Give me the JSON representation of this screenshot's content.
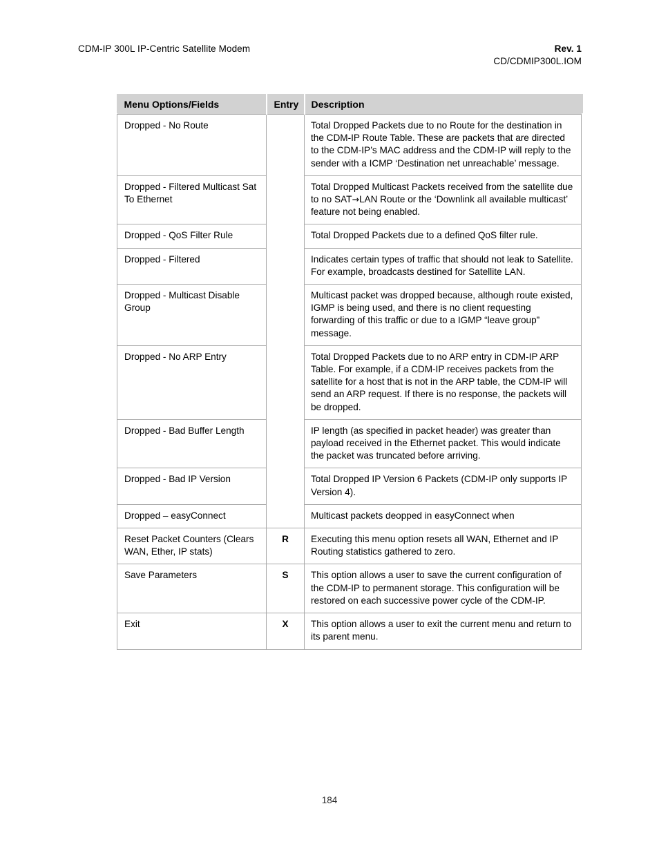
{
  "header": {
    "left_title": "CDM-IP 300L IP-Centric Satellite Modem",
    "right_rev": "Rev. 1",
    "right_docnum": "CD/CDMIP300L.IOM"
  },
  "table": {
    "columns": {
      "name": "Menu Options/Fields",
      "entry": "Entry",
      "description": "Description"
    },
    "rows": [
      {
        "name": "Dropped - No Route",
        "entry": "",
        "description": "Total Dropped Packets due to no Route for the destination in the CDM-IP Route Table. These are packets that are directed to the CDM-IP’s MAC address and the CDM-IP will reply to the sender with a ICMP ‘Destination net unreachable’ message."
      },
      {
        "name": "Dropped - Filtered Multicast Sat To Ethernet",
        "entry": "",
        "description_pre": "Total Dropped Multicast Packets received from the satellite due to no SAT",
        "description_arrow": "→",
        "description_post": "LAN Route or the ‘Downlink all available multicast’ feature not being enabled."
      },
      {
        "name": "Dropped - QoS Filter Rule",
        "entry": "",
        "description": "Total Dropped Packets due to a defined QoS filter rule."
      },
      {
        "name": "Dropped - Filtered",
        "entry": "",
        "description": "Indicates certain types of traffic that should not leak to Satellite. For example, broadcasts destined for Satellite LAN."
      },
      {
        "name": "Dropped - Multicast Disable Group",
        "entry": "",
        "description": "Multicast packet was dropped because, although route existed, IGMP is being used, and there is no client requesting forwarding of this traffic or due to a IGMP “leave group” message."
      },
      {
        "name": "Dropped - No ARP Entry",
        "entry": "",
        "description": "Total Dropped Packets due to no ARP entry in CDM-IP ARP Table. For example, if a CDM-IP receives packets from the satellite for a host that is not in the ARP table, the CDM-IP will send an ARP request. If there is no response, the packets will be dropped."
      },
      {
        "name": "Dropped - Bad Buffer Length",
        "entry": "",
        "description": "IP length (as specified in packet header) was greater than payload received in the Ethernet packet. This would indicate the packet was truncated before arriving."
      },
      {
        "name": "Dropped - Bad IP Version",
        "entry": "",
        "description": "Total Dropped IP Version 6 Packets (CDM-IP only supports IP Version 4)."
      },
      {
        "name": "Dropped – easyConnect",
        "entry": "",
        "description": "Multicast packets deopped in easyConnect when"
      },
      {
        "name": "Reset Packet Counters (Clears WAN, Ether, IP stats)",
        "entry": "R",
        "description": "Executing this menu option resets all WAN, Ethernet and IP Routing statistics gathered to zero."
      },
      {
        "name": "Save Parameters",
        "entry": "S",
        "description": "This option allows a user to save the current configuration of the CDM-IP to permanent storage. This configuration will be restored on each successive power cycle of the CDM-IP."
      },
      {
        "name": "Exit",
        "entry": "X",
        "description": "This option allows a user to exit the current menu and return to its parent menu."
      }
    ]
  },
  "footer": {
    "page_number": "184"
  }
}
